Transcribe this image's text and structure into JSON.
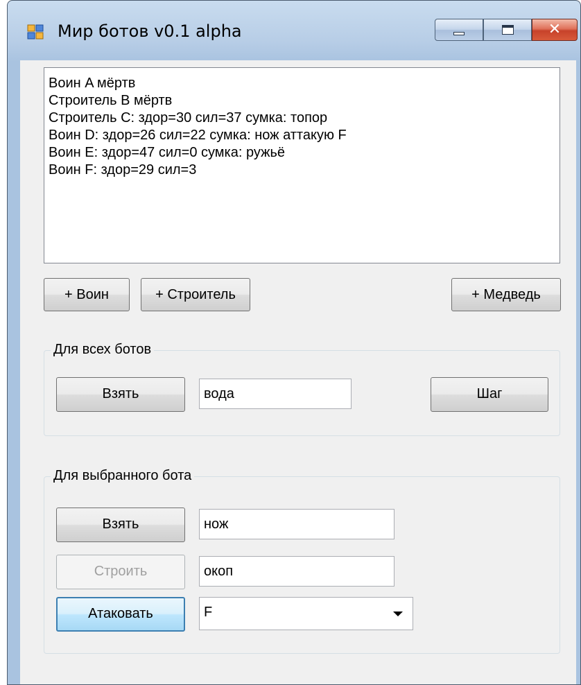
{
  "window": {
    "title": "Мир ботов v0.1 alpha",
    "close_glyph": "✕"
  },
  "log": {
    "lines": [
      "Воин A мёртв",
      "Строитель B мёртв",
      "Строитель C: здор=30 сил=37 сумка: топор",
      "Воин D: здор=26 сил=22 сумка: нож аттакую F",
      "Воин E: здор=47 сил=0 сумка: ружьё",
      "Воин F: здор=29 сил=3"
    ]
  },
  "add_buttons": {
    "warrior": "+ Воин",
    "builder": "+ Строитель",
    "bear": "+ Медведь"
  },
  "all_bots": {
    "label": "Для всех ботов",
    "take_button": "Взять",
    "take_value": "вода",
    "step_button": "Шаг"
  },
  "selected_bot": {
    "label": "Для выбранного бота",
    "take_button": "Взять",
    "take_value": "нож",
    "build_button": "Строить",
    "build_value": "окоп",
    "attack_button": "Атаковать",
    "attack_target": "F"
  },
  "colors": {
    "titlebar": "#b7cde6",
    "client": "#f0f0f0",
    "focus_border": "#3c7fb1"
  },
  "icons": {
    "app": "app-icon",
    "minimize": "minimize-icon",
    "maximize": "maximize-icon",
    "close": "close-icon",
    "dropdown": "chevron-down-icon"
  }
}
